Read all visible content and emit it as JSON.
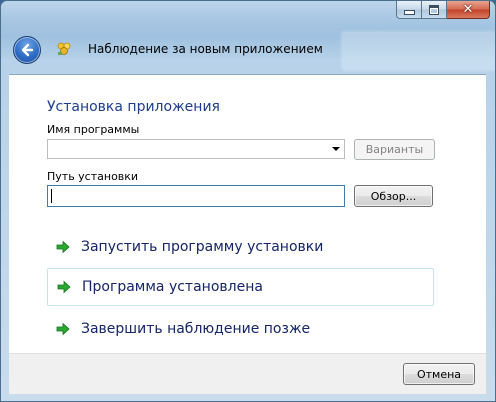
{
  "window": {
    "title": "Наблюдение за новым приложением"
  },
  "header": {
    "section_title": "Установка приложения"
  },
  "program": {
    "label": "Имя программы",
    "value": "",
    "variants_button": "Варианты"
  },
  "path": {
    "label": "Путь установки",
    "value": "",
    "browse_button": "Обзор..."
  },
  "tasks": [
    {
      "label": "Запустить программу установки"
    },
    {
      "label": "Программа установлена"
    },
    {
      "label": "Завершить наблюдение позже"
    }
  ],
  "footer": {
    "cancel_button": "Отмена"
  },
  "icons": {
    "back": "back-arrow-icon",
    "app": "program-compatibility-icon",
    "task": "green-arrow-icon"
  },
  "colors": {
    "accent_title": "#1e3d8f",
    "task_text": "#152566",
    "task_arrow": "#2aa834"
  }
}
